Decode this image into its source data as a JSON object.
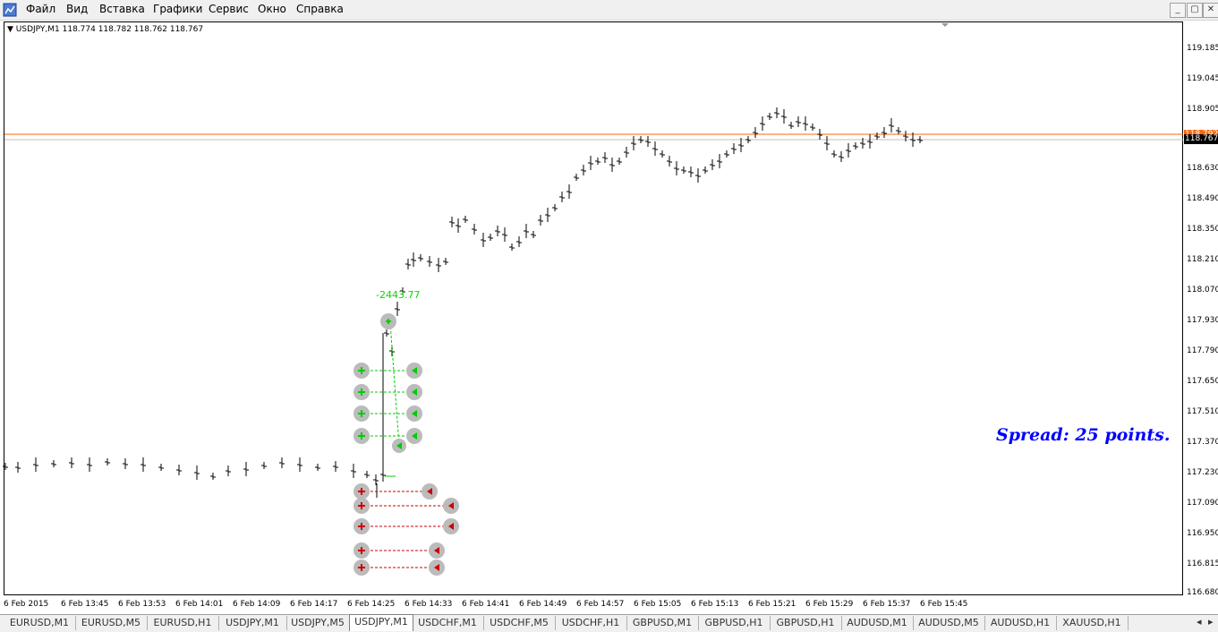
{
  "menu": {
    "items": [
      "Файл",
      "Вид",
      "Вставка",
      "Графики",
      "Сервис",
      "Окно",
      "Справка"
    ]
  },
  "window_controls": {
    "minimize": "_",
    "restore": "▢",
    "close": "✕"
  },
  "symbol_info": "USDJPY,M1  118.774 118.782 118.762 118.767",
  "price_axis": [
    "119.185",
    "119.045",
    "118.905",
    "118.767",
    "118.630",
    "118.490",
    "118.350",
    "118.210",
    "118.070",
    "117.930",
    "117.790",
    "117.650",
    "117.510",
    "117.370",
    "117.230",
    "117.090",
    "116.950",
    "116.815",
    "116.680"
  ],
  "current_price": "118.767",
  "ask_price": "118.792",
  "time_axis": [
    "6 Feb 2015",
    "6 Feb 13:45",
    "6 Feb 13:53",
    "6 Feb 14:01",
    "6 Feb 14:09",
    "6 Feb 14:17",
    "6 Feb 14:25",
    "6 Feb 14:33",
    "6 Feb 14:41",
    "6 Feb 14:49",
    "6 Feb 14:57",
    "6 Feb 15:05",
    "6 Feb 15:13",
    "6 Feb 15:21",
    "6 Feb 15:29",
    "6 Feb 15:37",
    "6 Feb 15:45"
  ],
  "spread_text": "Spread: 25 points.",
  "profit_label": "-2443.77",
  "tabs": [
    "EURUSD,M1",
    "EURUSD,M5",
    "EURUSD,H1",
    "USDJPY,M1",
    "USDJPY,M5",
    "USDJPY,M1",
    "USDCHF,M1",
    "USDCHF,M5",
    "USDCHF,H1",
    "GBPUSD,M1",
    "GBPUSD,H1",
    "GBPUSD,H1",
    "AUDUSD,M1",
    "AUDUSD,M5",
    "AUDUSD,H1",
    "XAUUSD,H1"
  ],
  "active_tab_index": 5,
  "colors": {
    "ask_line": "#ff6600",
    "bid_line": "#c0c0c0",
    "buy": "#00cc00",
    "sell": "#cc0000",
    "spread": "#0000ff"
  }
}
